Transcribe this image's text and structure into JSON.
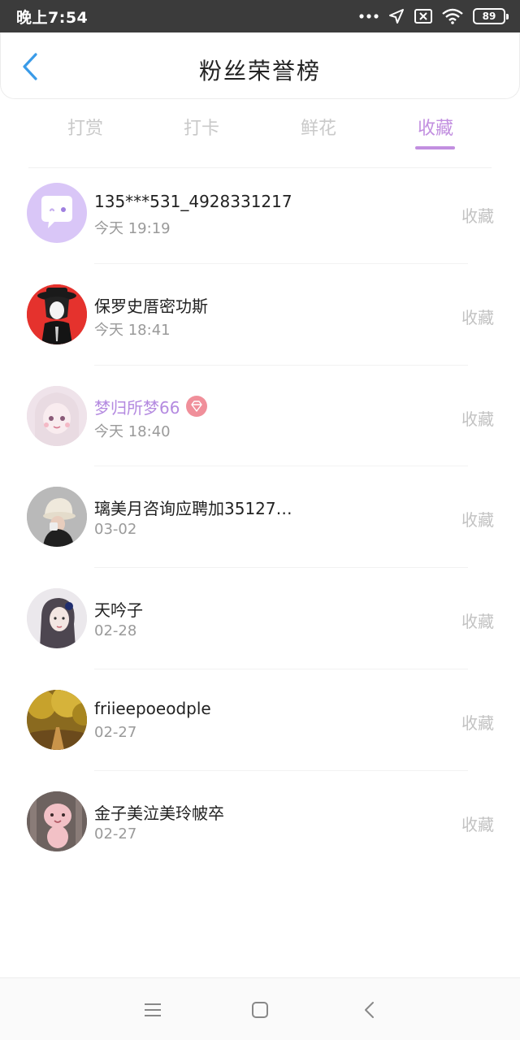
{
  "status_bar": {
    "time": "晚上7:54",
    "battery": "89",
    "icons": [
      "more-dots-icon",
      "location-arrow-icon",
      "no-sim-icon",
      "wifi-icon",
      "battery-icon"
    ]
  },
  "header": {
    "title": "粉丝荣誉榜",
    "back_icon": "chevron-left-icon"
  },
  "tabs": [
    {
      "label": "打赏",
      "active": false
    },
    {
      "label": "打卡",
      "active": false
    },
    {
      "label": "鲜花",
      "active": false
    },
    {
      "label": "收藏",
      "active": true
    }
  ],
  "colors": {
    "accent": "#c28fe0",
    "vip_name": "#b48ae0",
    "vip_badge": "#f08f9a",
    "muted_text": "#9a9a9a",
    "action_text": "#c2c2c2"
  },
  "fans": [
    {
      "name": "135***531_4928331217",
      "time": "今天 19:19",
      "action": "收藏",
      "vip": false,
      "avatar": "default-chat-avatar"
    },
    {
      "name": "保罗史厝密功斯",
      "time": "今天 18:41",
      "action": "收藏",
      "vip": false,
      "avatar": "red-anime-avatar"
    },
    {
      "name": "梦归所梦66",
      "time": "今天 18:40",
      "action": "收藏",
      "vip": true,
      "avatar": "pink-anime-avatar"
    },
    {
      "name": "璃美月咨询应聘加35127…",
      "time": "03-02",
      "action": "收藏",
      "vip": false,
      "avatar": "hat-person-avatar"
    },
    {
      "name": "天吟子",
      "time": "02-28",
      "action": "收藏",
      "vip": false,
      "avatar": "girl-portrait-avatar"
    },
    {
      "name": "friieepoeodple",
      "time": "02-27",
      "action": "收藏",
      "vip": false,
      "avatar": "autumn-forest-avatar"
    },
    {
      "name": "金子美泣美玲帔卒",
      "time": "02-27",
      "action": "收藏",
      "vip": false,
      "avatar": "cartoon-baby-avatar"
    }
  ],
  "nav_bar": {
    "icons": [
      "menu-icon",
      "home-square-icon",
      "back-triangle-icon"
    ]
  }
}
